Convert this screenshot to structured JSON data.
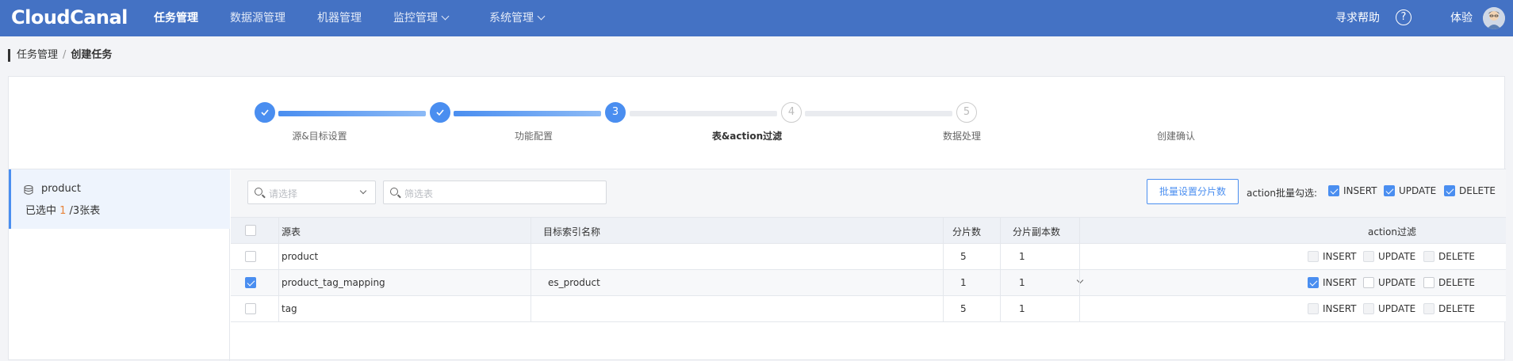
{
  "topbar": {
    "logo": "CloudCanal",
    "nav": [
      {
        "label": "任务管理",
        "active": true
      },
      {
        "label": "数据源管理"
      },
      {
        "label": "机器管理"
      },
      {
        "label": "监控管理",
        "dropdown": true
      },
      {
        "label": "系统管理",
        "dropdown": true
      }
    ],
    "help": "寻求帮助",
    "help_icon": "?",
    "user": "体验"
  },
  "breadcrumb": {
    "parent": "任务管理",
    "separator": "/",
    "current": "创建任务"
  },
  "steps": [
    {
      "num": "1",
      "label": "源&目标设置",
      "state": "done"
    },
    {
      "num": "2",
      "label": "功能配置",
      "state": "done"
    },
    {
      "num": "3",
      "label": "表&action过滤",
      "state": "current"
    },
    {
      "num": "4",
      "label": "数据处理",
      "state": "todo"
    },
    {
      "num": "5",
      "label": "创建确认",
      "state": "todo"
    }
  ],
  "left": {
    "db_name": "product",
    "count_prefix": "已选中 ",
    "count_selected": "1",
    "count_suffix": " /3张表"
  },
  "toolbar": {
    "select_placeholder": "请选择",
    "filter_placeholder": "筛选表",
    "batch_button": "批量设置分片数",
    "batch_label": "action批量勾选:",
    "batch_actions": [
      {
        "label": "INSERT",
        "checked": true
      },
      {
        "label": "UPDATE",
        "checked": true
      },
      {
        "label": "DELETE",
        "checked": true
      }
    ]
  },
  "table": {
    "headers": {
      "source": "源表",
      "target": "目标索引名称",
      "shards": "分片数",
      "replicas": "分片副本数",
      "action": "action过滤"
    },
    "rows": [
      {
        "checked": false,
        "source": "product",
        "target": "",
        "shards": "5",
        "replicas": "1",
        "insert": false,
        "update": false,
        "delete": false
      },
      {
        "checked": true,
        "source": "product_tag_mapping",
        "target": "es_product",
        "shards": "1",
        "replicas": "1",
        "insert": true,
        "update": false,
        "delete": false
      },
      {
        "checked": false,
        "source": "tag",
        "target": "",
        "shards": "5",
        "replicas": "1",
        "insert": false,
        "update": false,
        "delete": false
      }
    ],
    "action_labels": {
      "insert": "INSERT",
      "update": "UPDATE",
      "delete": "DELETE"
    }
  },
  "colors": {
    "primary": "#4472c4",
    "accent": "#4a8ef0",
    "count": "#e8833a"
  },
  "icons": {
    "help": "help-circle-icon",
    "db": "database-icon",
    "search": "search-icon"
  }
}
